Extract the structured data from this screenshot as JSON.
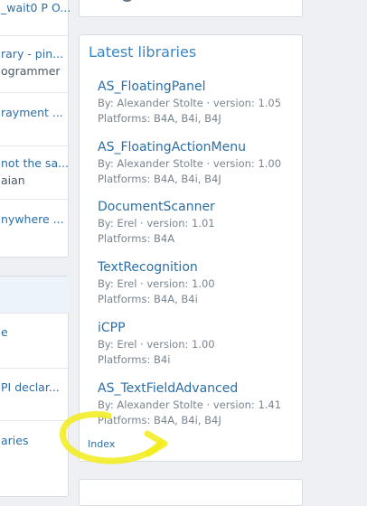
{
  "left_top": {
    "items": [
      [
        "_wait0 P O...",
        ""
      ],
      [
        "rary - pin...",
        "ogrammer"
      ],
      [
        "rayment ...",
        ""
      ],
      [
        "not the sa...",
        "aian"
      ],
      [
        "nywhere ...",
        ""
      ]
    ]
  },
  "left_bottom": {
    "items": [
      [
        "e",
        ""
      ],
      [
        "PI declar...",
        ""
      ],
      [
        "aries",
        ""
      ]
    ]
  },
  "latest": {
    "title": "Latest libraries",
    "libraries": [
      {
        "name": "AS_FloatingPanel",
        "by": "By: Alexander Stolte · version: 1.05",
        "platforms": "Platforms: B4A, B4i, B4J"
      },
      {
        "name": "AS_FloatingActionMenu",
        "by": "By: Alexander Stolte · version: 1.00",
        "platforms": "Platforms: B4A, B4i, B4J"
      },
      {
        "name": "DocumentScanner",
        "by": "By: Erel · version: 1.01",
        "platforms": "Platforms: B4A"
      },
      {
        "name": "TextRecognition",
        "by": "By: Erel · version: 1.00",
        "platforms": "Platforms: B4A, B4i"
      },
      {
        "name": "iCPP",
        "by": "By: Erel · version: 1.00",
        "platforms": "Platforms: B4i"
      },
      {
        "name": "AS_TextFieldAdvanced",
        "by": "By: Alexander Stolte · version: 1.41",
        "platforms": "Platforms: B4A, B4i, B4J"
      }
    ],
    "index_label": "Index"
  },
  "colors": {
    "link": "#2b6ea6",
    "title": "#3a86c4",
    "meta": "#7a848e",
    "highlight": "#f2ec1a"
  },
  "icons": {
    "top_right_menu": "menu-icon"
  }
}
